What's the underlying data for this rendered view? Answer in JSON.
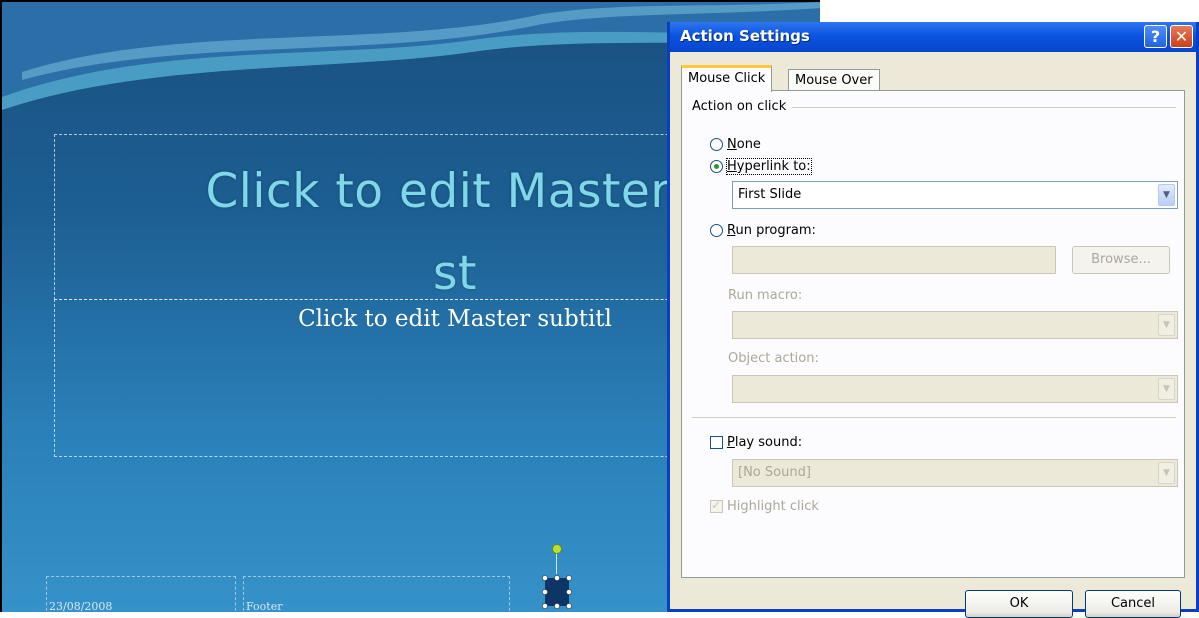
{
  "slide": {
    "title": "Click to edit Master t",
    "title_line2": "st",
    "subtitle": "Click to edit Master subtitl",
    "date": "23/08/2008",
    "footer": "Footer"
  },
  "dialog": {
    "title": "Action Settings",
    "help_glyph": "?",
    "close_glyph": "✕",
    "tabs": [
      {
        "label": "Mouse Click",
        "active": true
      },
      {
        "label": "Mouse Over",
        "active": false
      }
    ],
    "group_label": "Action on click",
    "none_label_u": "N",
    "none_label_rest": "one",
    "hyperlink_label_u": "H",
    "hyperlink_label_rest": "yperlink to:",
    "hyperlink_value": "First Slide",
    "run_program_u": "R",
    "run_program_rest": "un program:",
    "browse_label": "Browse...",
    "run_macro_label": "Run macro:",
    "object_action_label": "Object action:",
    "play_sound_u": "P",
    "play_sound_rest": "lay sound:",
    "sound_value": "[No Sound]",
    "highlight_label": "Highlight click",
    "ok_label": "OK",
    "cancel_label": "Cancel",
    "selected_action": "hyperlink",
    "play_sound_checked": false,
    "highlight_checked": true
  },
  "colors": {
    "title_text": "#7fd7e8",
    "xp_blue": "#0a54e0",
    "dialog_face": "#ece9d8"
  }
}
